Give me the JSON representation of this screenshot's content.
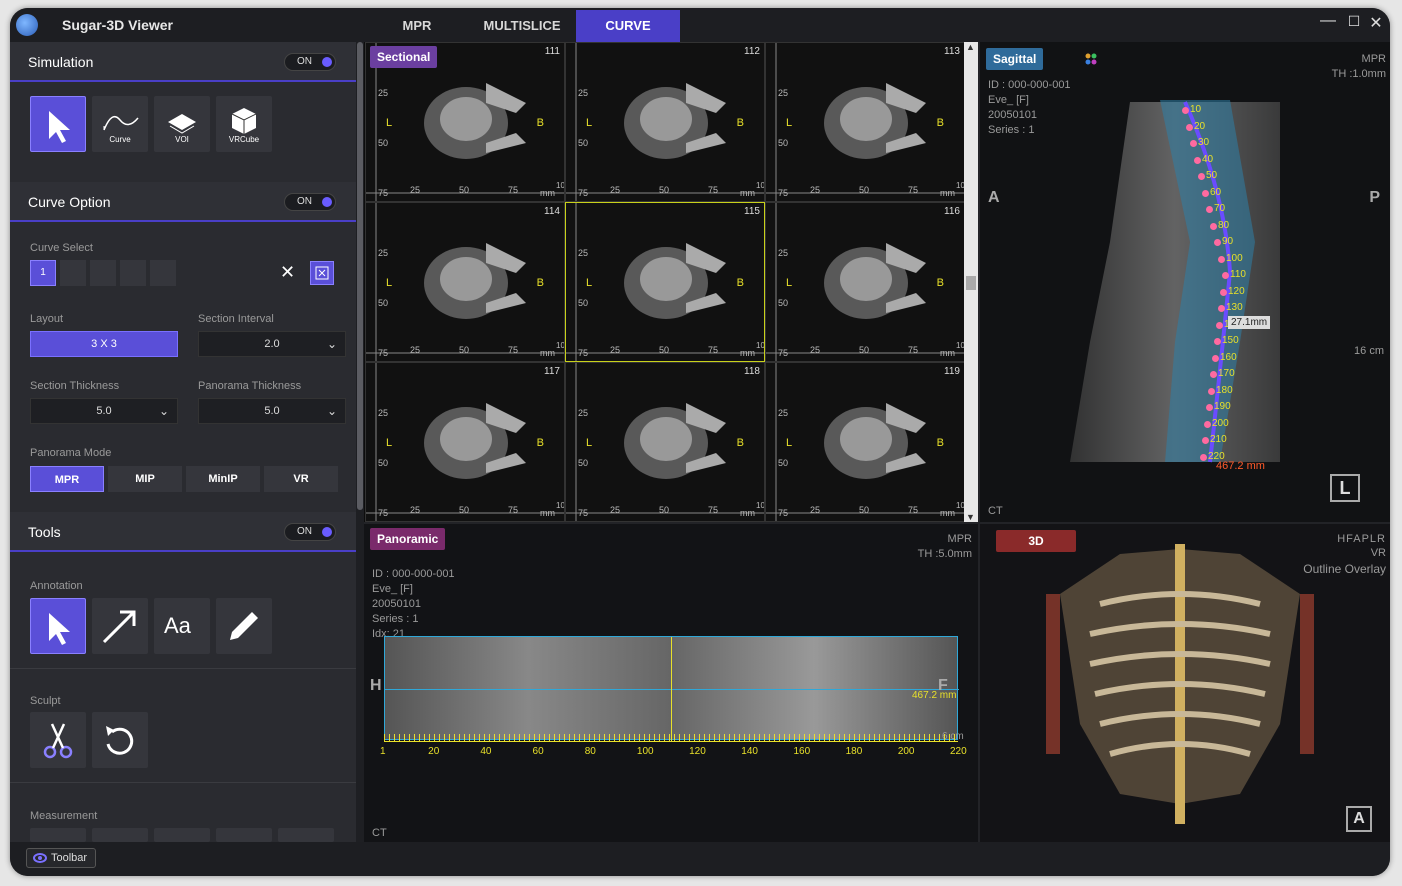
{
  "app": {
    "title": "Sugar-3D Viewer"
  },
  "tabs": [
    {
      "label": "MPR"
    },
    {
      "label": "MULTISLICE"
    },
    {
      "label": "CURVE"
    }
  ],
  "left": {
    "simulation": {
      "title": "Simulation",
      "toggle": "ON",
      "tools": [
        {
          "label": ""
        },
        {
          "label": "Curve"
        },
        {
          "label": "VOI"
        },
        {
          "label": "VRCube"
        }
      ]
    },
    "curve_option": {
      "title": "Curve Option",
      "toggle": "ON",
      "curve_select_label": "Curve Select",
      "curve_selected": "1",
      "layout_label": "Layout",
      "layout_value": "3 X 3",
      "section_interval_label": "Section Interval",
      "section_interval_value": "2.0",
      "section_thickness_label": "Section Thickness",
      "section_thickness_value": "5.0",
      "panorama_thickness_label": "Panorama Thickness",
      "panorama_thickness_value": "5.0",
      "panorama_mode_label": "Panorama Mode",
      "panorama_modes": [
        "MPR",
        "MIP",
        "MinIP",
        "VR"
      ]
    },
    "tools": {
      "title": "Tools",
      "toggle": "ON",
      "annotation_label": "Annotation",
      "text_tool": "Aa",
      "sculpt_label": "Sculpt",
      "measurement_label": "Measurement"
    }
  },
  "sectional": {
    "badge": "Sectional",
    "cells": [
      {
        "num": "111"
      },
      {
        "num": "112"
      },
      {
        "num": "113"
      },
      {
        "num": "114"
      },
      {
        "num": "115"
      },
      {
        "num": "116"
      },
      {
        "num": "117"
      },
      {
        "num": "118"
      },
      {
        "num": "119"
      }
    ],
    "left_marker": "L",
    "right_marker": "B",
    "y_ticks": [
      "25",
      "50",
      "75"
    ],
    "x_ticks": [
      "25",
      "50",
      "75"
    ],
    "unit": "mm",
    "unit_tail": "10"
  },
  "sagittal": {
    "badge": "Sagittal",
    "mode": "MPR",
    "th": "TH :1.0mm",
    "id": "ID : 000-000-001",
    "name": "Eve_ [F]",
    "date": "20050101",
    "series": "Series : 1",
    "left_dir": "A",
    "right_dir": "P",
    "scale": "16 cm",
    "modality": "CT",
    "orient": "L",
    "length": "467.2 mm",
    "hover": "27.1mm",
    "curve_labels": [
      "10",
      "20",
      "30",
      "40",
      "50",
      "60",
      "70",
      "80",
      "90",
      "100",
      "110",
      "120",
      "130",
      "140",
      "150",
      "160",
      "170",
      "180",
      "190",
      "200",
      "210",
      "220"
    ]
  },
  "panoramic": {
    "badge": "Panoramic",
    "mode": "MPR",
    "th": "TH :5.0mm",
    "id": "ID : 000-000-001",
    "name": "Eve_ [F]",
    "date": "20050101",
    "series": "Series : 1",
    "idx": "Idx: 21",
    "left_dir": "H",
    "right_dir": "F",
    "length": "467.2 mm",
    "scale": "6 cm",
    "modality": "CT",
    "x_ticks": [
      "1",
      "20",
      "40",
      "60",
      "80",
      "100",
      "120",
      "140",
      "160",
      "180",
      "200",
      "220"
    ]
  },
  "vr3d": {
    "badge": "3D",
    "orient": "HFAPLR",
    "mode": "VR",
    "overlay": "Outline Overlay",
    "corner": "A"
  },
  "status": {
    "toolbar": "Toolbar"
  },
  "colors": {
    "accent": "#5a4fd8",
    "sectional_badge": "#6b3fa0",
    "sagittal_badge": "#2f6b9a",
    "panoramic_badge": "#7a2a6b",
    "vr_badge": "#8a2a2a",
    "marker": "#e8e02a"
  }
}
